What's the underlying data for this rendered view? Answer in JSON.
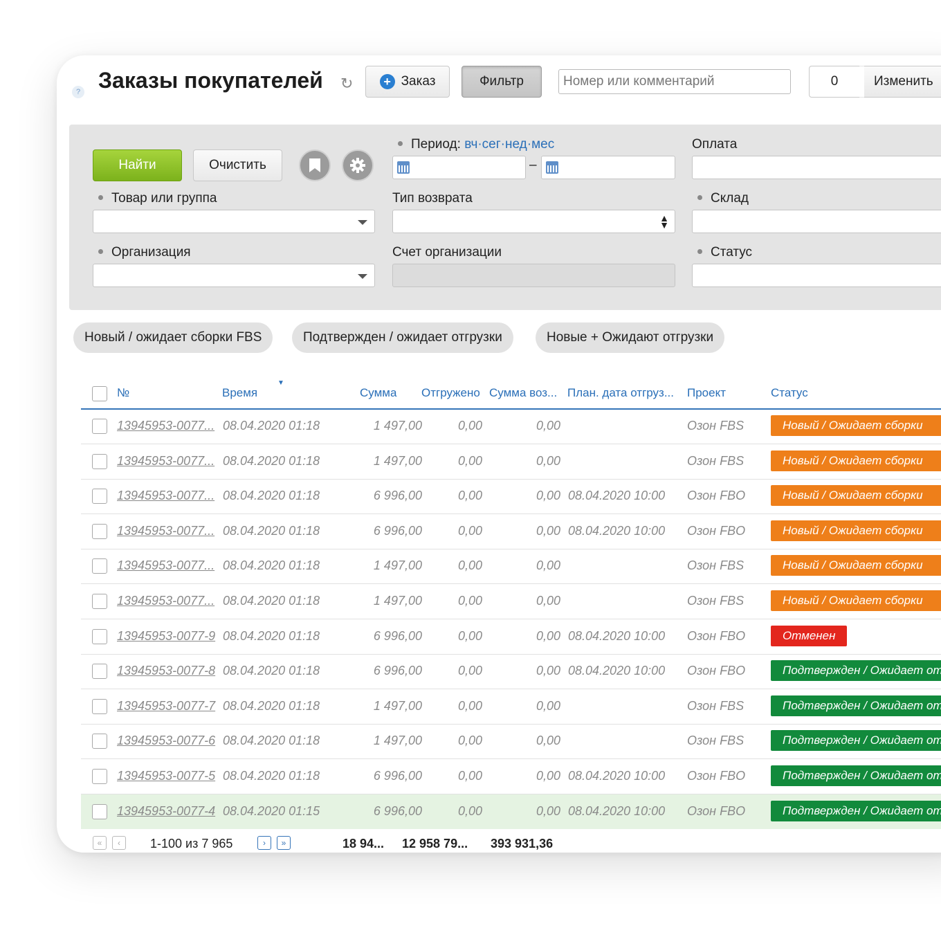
{
  "header": {
    "help": "?",
    "title": "Заказы покупателей",
    "order_button": "Заказ",
    "filter_button": "Фильтр",
    "search_placeholder": "Номер или комментарий",
    "counter": "0",
    "change_button": "Изменить"
  },
  "filter": {
    "find_button": "Найти",
    "clear_button": "Очистить",
    "period_label": "Период:",
    "period_links": [
      "вч",
      "сег",
      "нед",
      "мес"
    ],
    "period_sep": "·",
    "date_dash": "–",
    "payment_label": "Оплата",
    "product_label": "Товар или группа",
    "return_type_label": "Тип возврата",
    "warehouse_label": "Склад",
    "organization_label": "Организация",
    "org_account_label": "Счет организации",
    "status_label": "Статус"
  },
  "chips": [
    "Новый / ожидает сборки FBS",
    "Подтвержден / ожидает отгрузки",
    "Новые + Ожидают отгрузки"
  ],
  "table": {
    "columns": [
      "№",
      "Время",
      "Сумма",
      "Отгружено",
      "Сумма воз...",
      "План. дата отгруз...",
      "Проект",
      "Статус"
    ],
    "rows": [
      {
        "num": "13945953-0077...",
        "time": "08.04.2020 01:18",
        "sum": "1 497,00",
        "shipped": "0,00",
        "returned": "0,00",
        "plan": "",
        "project": "Озон FBS",
        "status": "Новый / Ожидает сборки",
        "color": "#ee7f1a"
      },
      {
        "num": "13945953-0077...",
        "time": "08.04.2020 01:18",
        "sum": "1 497,00",
        "shipped": "0,00",
        "returned": "0,00",
        "plan": "",
        "project": "Озон FBS",
        "status": "Новый / Ожидает сборки",
        "color": "#ee7f1a"
      },
      {
        "num": "13945953-0077...",
        "time": "08.04.2020 01:18",
        "sum": "6 996,00",
        "shipped": "0,00",
        "returned": "0,00",
        "plan": "08.04.2020 10:00",
        "project": "Озон FBO",
        "status": "Новый / Ожидает сборки",
        "color": "#ee7f1a"
      },
      {
        "num": "13945953-0077...",
        "time": "08.04.2020 01:18",
        "sum": "6 996,00",
        "shipped": "0,00",
        "returned": "0,00",
        "plan": "08.04.2020 10:00",
        "project": "Озон FBO",
        "status": "Новый / Ожидает сборки",
        "color": "#ee7f1a"
      },
      {
        "num": "13945953-0077...",
        "time": "08.04.2020 01:18",
        "sum": "1 497,00",
        "shipped": "0,00",
        "returned": "0,00",
        "plan": "",
        "project": "Озон FBS",
        "status": "Новый / Ожидает сборки",
        "color": "#ee7f1a"
      },
      {
        "num": "13945953-0077...",
        "time": "08.04.2020 01:18",
        "sum": "1 497,00",
        "shipped": "0,00",
        "returned": "0,00",
        "plan": "",
        "project": "Озон FBS",
        "status": "Новый / Ожидает сборки",
        "color": "#ee7f1a"
      },
      {
        "num": "13945953-0077-9",
        "time": "08.04.2020 01:18",
        "sum": "6 996,00",
        "shipped": "0,00",
        "returned": "0,00",
        "plan": "08.04.2020 10:00",
        "project": "Озон FBO",
        "status": "Отменен",
        "color": "#e3261d"
      },
      {
        "num": "13945953-0077-8",
        "time": "08.04.2020 01:18",
        "sum": "6 996,00",
        "shipped": "0,00",
        "returned": "0,00",
        "plan": "08.04.2020 10:00",
        "project": "Озон FBO",
        "status": "Подтвержден / Ожидает отгрузки",
        "color": "#128a3c"
      },
      {
        "num": "13945953-0077-7",
        "time": "08.04.2020 01:18",
        "sum": "1 497,00",
        "shipped": "0,00",
        "returned": "0,00",
        "plan": "",
        "project": "Озон FBS",
        "status": "Подтвержден / Ожидает отгрузки",
        "color": "#128a3c"
      },
      {
        "num": "13945953-0077-6",
        "time": "08.04.2020 01:18",
        "sum": "1 497,00",
        "shipped": "0,00",
        "returned": "0,00",
        "plan": "",
        "project": "Озон FBS",
        "status": "Подтвержден / Ожидает отгрузки",
        "color": "#128a3c"
      },
      {
        "num": "13945953-0077-5",
        "time": "08.04.2020 01:18",
        "sum": "6 996,00",
        "shipped": "0,00",
        "returned": "0,00",
        "plan": "08.04.2020 10:00",
        "project": "Озон FBO",
        "status": "Подтвержден / Ожидает отгрузки",
        "color": "#128a3c"
      },
      {
        "num": "13945953-0077-4",
        "time": "08.04.2020 01:15",
        "sum": "6 996,00",
        "shipped": "0,00",
        "returned": "0,00",
        "plan": "08.04.2020 10:00",
        "project": "Озон FBO",
        "status": "Подтвержден / Ожидает отгрузки",
        "color": "#128a3c",
        "highlighted": true
      }
    ]
  },
  "footer": {
    "range": "1-100 из 7 965",
    "total_sum": "18 94...",
    "total_shipped": "12 958 79...",
    "total_returned": "393 931,36"
  }
}
